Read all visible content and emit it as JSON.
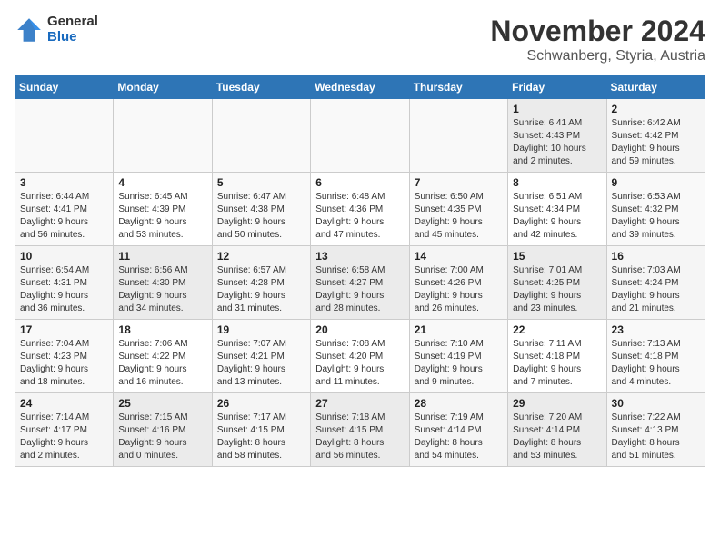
{
  "header": {
    "logo_general": "General",
    "logo_blue": "Blue",
    "main_title": "November 2024",
    "subtitle": "Schwanberg, Styria, Austria"
  },
  "weekdays": [
    "Sunday",
    "Monday",
    "Tuesday",
    "Wednesday",
    "Thursday",
    "Friday",
    "Saturday"
  ],
  "weeks": [
    [
      {
        "day": "",
        "info": ""
      },
      {
        "day": "",
        "info": ""
      },
      {
        "day": "",
        "info": ""
      },
      {
        "day": "",
        "info": ""
      },
      {
        "day": "",
        "info": ""
      },
      {
        "day": "1",
        "info": "Sunrise: 6:41 AM\nSunset: 4:43 PM\nDaylight: 10 hours\nand 2 minutes."
      },
      {
        "day": "2",
        "info": "Sunrise: 6:42 AM\nSunset: 4:42 PM\nDaylight: 9 hours\nand 59 minutes."
      }
    ],
    [
      {
        "day": "3",
        "info": "Sunrise: 6:44 AM\nSunset: 4:41 PM\nDaylight: 9 hours\nand 56 minutes."
      },
      {
        "day": "4",
        "info": "Sunrise: 6:45 AM\nSunset: 4:39 PM\nDaylight: 9 hours\nand 53 minutes."
      },
      {
        "day": "5",
        "info": "Sunrise: 6:47 AM\nSunset: 4:38 PM\nDaylight: 9 hours\nand 50 minutes."
      },
      {
        "day": "6",
        "info": "Sunrise: 6:48 AM\nSunset: 4:36 PM\nDaylight: 9 hours\nand 47 minutes."
      },
      {
        "day": "7",
        "info": "Sunrise: 6:50 AM\nSunset: 4:35 PM\nDaylight: 9 hours\nand 45 minutes."
      },
      {
        "day": "8",
        "info": "Sunrise: 6:51 AM\nSunset: 4:34 PM\nDaylight: 9 hours\nand 42 minutes."
      },
      {
        "day": "9",
        "info": "Sunrise: 6:53 AM\nSunset: 4:32 PM\nDaylight: 9 hours\nand 39 minutes."
      }
    ],
    [
      {
        "day": "10",
        "info": "Sunrise: 6:54 AM\nSunset: 4:31 PM\nDaylight: 9 hours\nand 36 minutes."
      },
      {
        "day": "11",
        "info": "Sunrise: 6:56 AM\nSunset: 4:30 PM\nDaylight: 9 hours\nand 34 minutes."
      },
      {
        "day": "12",
        "info": "Sunrise: 6:57 AM\nSunset: 4:28 PM\nDaylight: 9 hours\nand 31 minutes."
      },
      {
        "day": "13",
        "info": "Sunrise: 6:58 AM\nSunset: 4:27 PM\nDaylight: 9 hours\nand 28 minutes."
      },
      {
        "day": "14",
        "info": "Sunrise: 7:00 AM\nSunset: 4:26 PM\nDaylight: 9 hours\nand 26 minutes."
      },
      {
        "day": "15",
        "info": "Sunrise: 7:01 AM\nSunset: 4:25 PM\nDaylight: 9 hours\nand 23 minutes."
      },
      {
        "day": "16",
        "info": "Sunrise: 7:03 AM\nSunset: 4:24 PM\nDaylight: 9 hours\nand 21 minutes."
      }
    ],
    [
      {
        "day": "17",
        "info": "Sunrise: 7:04 AM\nSunset: 4:23 PM\nDaylight: 9 hours\nand 18 minutes."
      },
      {
        "day": "18",
        "info": "Sunrise: 7:06 AM\nSunset: 4:22 PM\nDaylight: 9 hours\nand 16 minutes."
      },
      {
        "day": "19",
        "info": "Sunrise: 7:07 AM\nSunset: 4:21 PM\nDaylight: 9 hours\nand 13 minutes."
      },
      {
        "day": "20",
        "info": "Sunrise: 7:08 AM\nSunset: 4:20 PM\nDaylight: 9 hours\nand 11 minutes."
      },
      {
        "day": "21",
        "info": "Sunrise: 7:10 AM\nSunset: 4:19 PM\nDaylight: 9 hours\nand 9 minutes."
      },
      {
        "day": "22",
        "info": "Sunrise: 7:11 AM\nSunset: 4:18 PM\nDaylight: 9 hours\nand 7 minutes."
      },
      {
        "day": "23",
        "info": "Sunrise: 7:13 AM\nSunset: 4:18 PM\nDaylight: 9 hours\nand 4 minutes."
      }
    ],
    [
      {
        "day": "24",
        "info": "Sunrise: 7:14 AM\nSunset: 4:17 PM\nDaylight: 9 hours\nand 2 minutes."
      },
      {
        "day": "25",
        "info": "Sunrise: 7:15 AM\nSunset: 4:16 PM\nDaylight: 9 hours\nand 0 minutes."
      },
      {
        "day": "26",
        "info": "Sunrise: 7:17 AM\nSunset: 4:15 PM\nDaylight: 8 hours\nand 58 minutes."
      },
      {
        "day": "27",
        "info": "Sunrise: 7:18 AM\nSunset: 4:15 PM\nDaylight: 8 hours\nand 56 minutes."
      },
      {
        "day": "28",
        "info": "Sunrise: 7:19 AM\nSunset: 4:14 PM\nDaylight: 8 hours\nand 54 minutes."
      },
      {
        "day": "29",
        "info": "Sunrise: 7:20 AM\nSunset: 4:14 PM\nDaylight: 8 hours\nand 53 minutes."
      },
      {
        "day": "30",
        "info": "Sunrise: 7:22 AM\nSunset: 4:13 PM\nDaylight: 8 hours\nand 51 minutes."
      }
    ]
  ]
}
